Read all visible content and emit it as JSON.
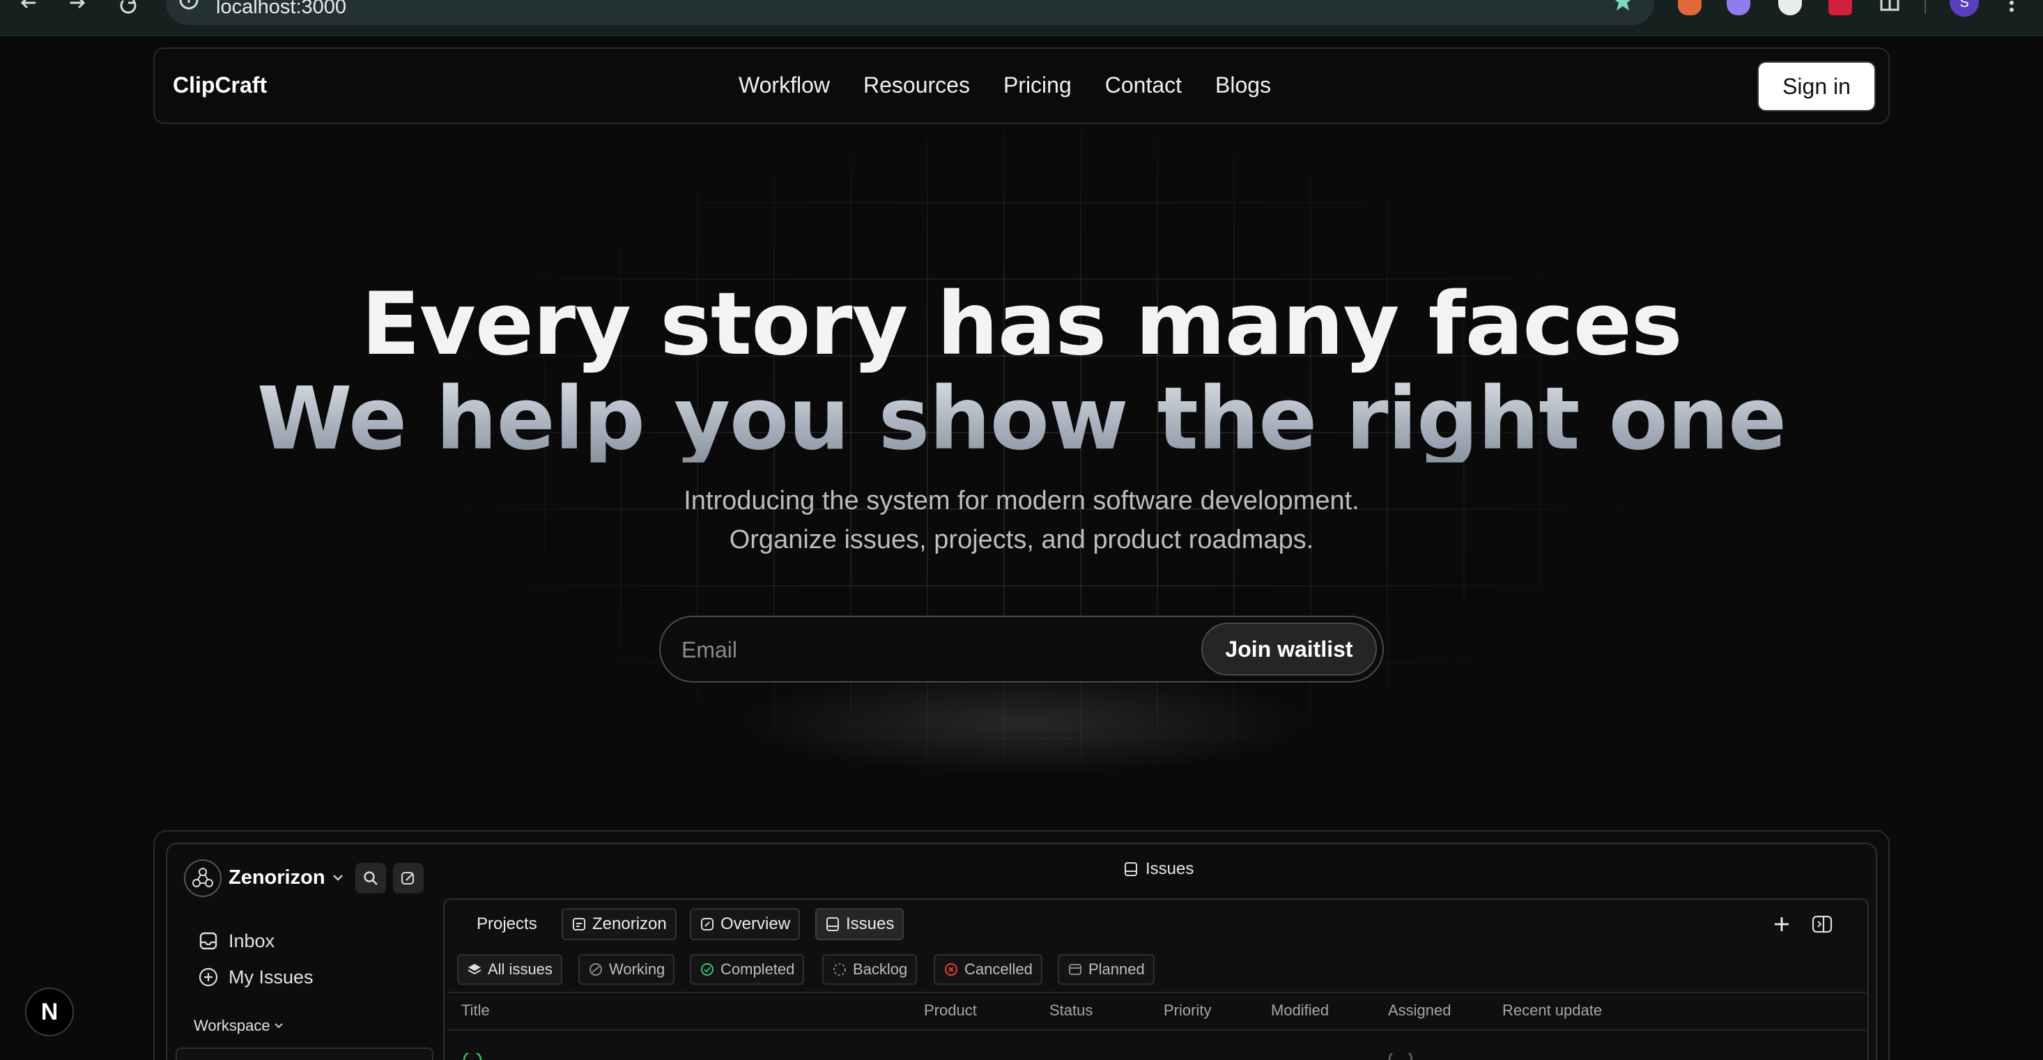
{
  "browser": {
    "url": "localhost:3000",
    "profile_initial": "S"
  },
  "navbar": {
    "brand": "ClipCraft",
    "links": [
      "Workflow",
      "Resources",
      "Pricing",
      "Contact",
      "Blogs"
    ],
    "signin_label": "Sign in"
  },
  "hero": {
    "title_line1": "Every story has many faces",
    "title_line2": "We help you show the right one",
    "subtitle_line1": "Introducing the system for modern software development.",
    "subtitle_line2": "Organize issues, projects, and product roadmaps."
  },
  "waitlist": {
    "email_placeholder": "Email",
    "button_label": "Join waitlist"
  },
  "preview": {
    "workspace_name": "Zenorizon",
    "sidebar": {
      "items": [
        "Inbox",
        "My Issues"
      ],
      "workspace_label": "Workspace"
    },
    "header_title": "Issues",
    "tabs": [
      "Projects",
      "Zenorizon",
      "Overview",
      "Issues"
    ],
    "active_tab": "Issues",
    "filters": [
      "All issues",
      "Working",
      "Completed",
      "Backlog",
      "Cancelled",
      "Planned"
    ],
    "active_filter": "All issues",
    "columns": [
      "Title",
      "Product",
      "Status",
      "Priority",
      "Modified",
      "Assigned",
      "Recent update"
    ]
  },
  "dev_badge": {
    "label": "N"
  },
  "colors": {
    "background": "#0a0a0a",
    "accent_completed": "#3fbf6a",
    "accent_cancelled": "#e0403a",
    "extension_1": "#e1683a",
    "extension_2": "#8f7df0",
    "extension_4": "#d21f3c",
    "profile": "#5a3fc0",
    "star": "#7fd6c4"
  }
}
